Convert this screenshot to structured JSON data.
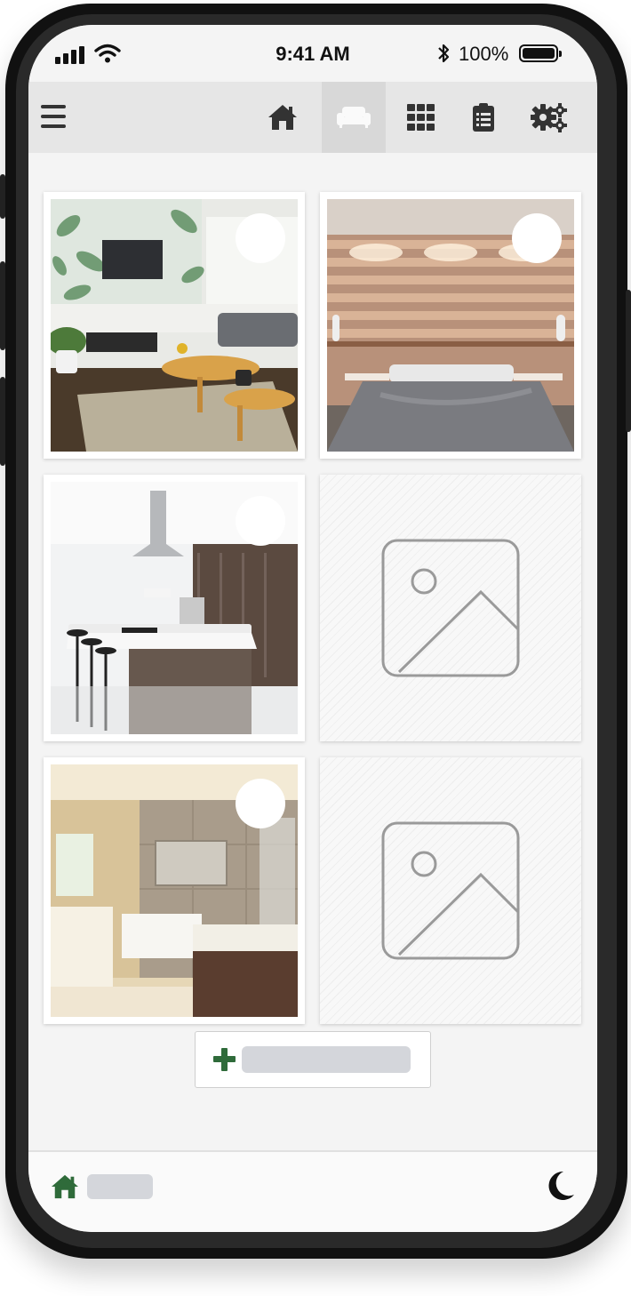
{
  "status": {
    "time": "9:41 AM",
    "battery": "100%",
    "icons": [
      "signal-icon",
      "wifi-icon",
      "bluetooth-icon",
      "battery-icon"
    ]
  },
  "nav": {
    "items": [
      {
        "name": "home-icon"
      },
      {
        "name": "sofa-icon",
        "active": true
      },
      {
        "name": "grid-icon"
      },
      {
        "name": "clipboard-icon"
      },
      {
        "name": "gears-icon"
      }
    ],
    "menu_icon": "menu-icon"
  },
  "rooms": [
    {
      "image": "living-room-photo"
    },
    {
      "image": "bedroom-photo"
    },
    {
      "image": "kitchen-photo"
    },
    {
      "image": "placeholder"
    },
    {
      "image": "bathroom-photo"
    },
    {
      "image": "placeholder"
    }
  ],
  "add_button": {
    "icon": "plus-icon"
  },
  "colors": {
    "accent": "#2f6b3a",
    "nav_bg": "#e6e6e6",
    "placeholder_label": "#d4d6db"
  },
  "footer": {
    "home_icon": "home-icon",
    "theme_icon": "moon-icon"
  }
}
